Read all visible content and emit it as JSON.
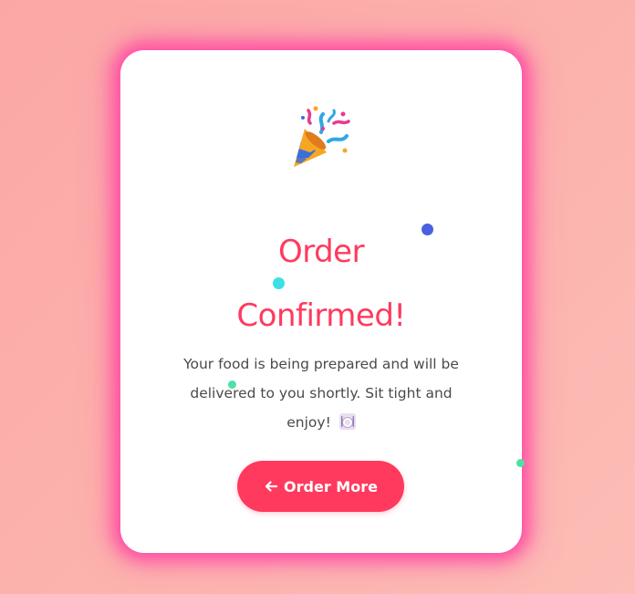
{
  "card": {
    "icon": "party-popper-icon",
    "title_line1": "Order",
    "title_line2": "Confirmed!",
    "message": "Your food is being prepared and will be delivered to you shortly. Sit tight and enjoy!",
    "message_icon": "plate-cutlery-icon",
    "button": {
      "label": "Order More",
      "icon": "arrow-left-icon"
    }
  },
  "colors": {
    "accent": "#ff3a5e",
    "glow": "#ff4fa3",
    "background": "#fba7a6",
    "text": "#4a4a4a"
  }
}
